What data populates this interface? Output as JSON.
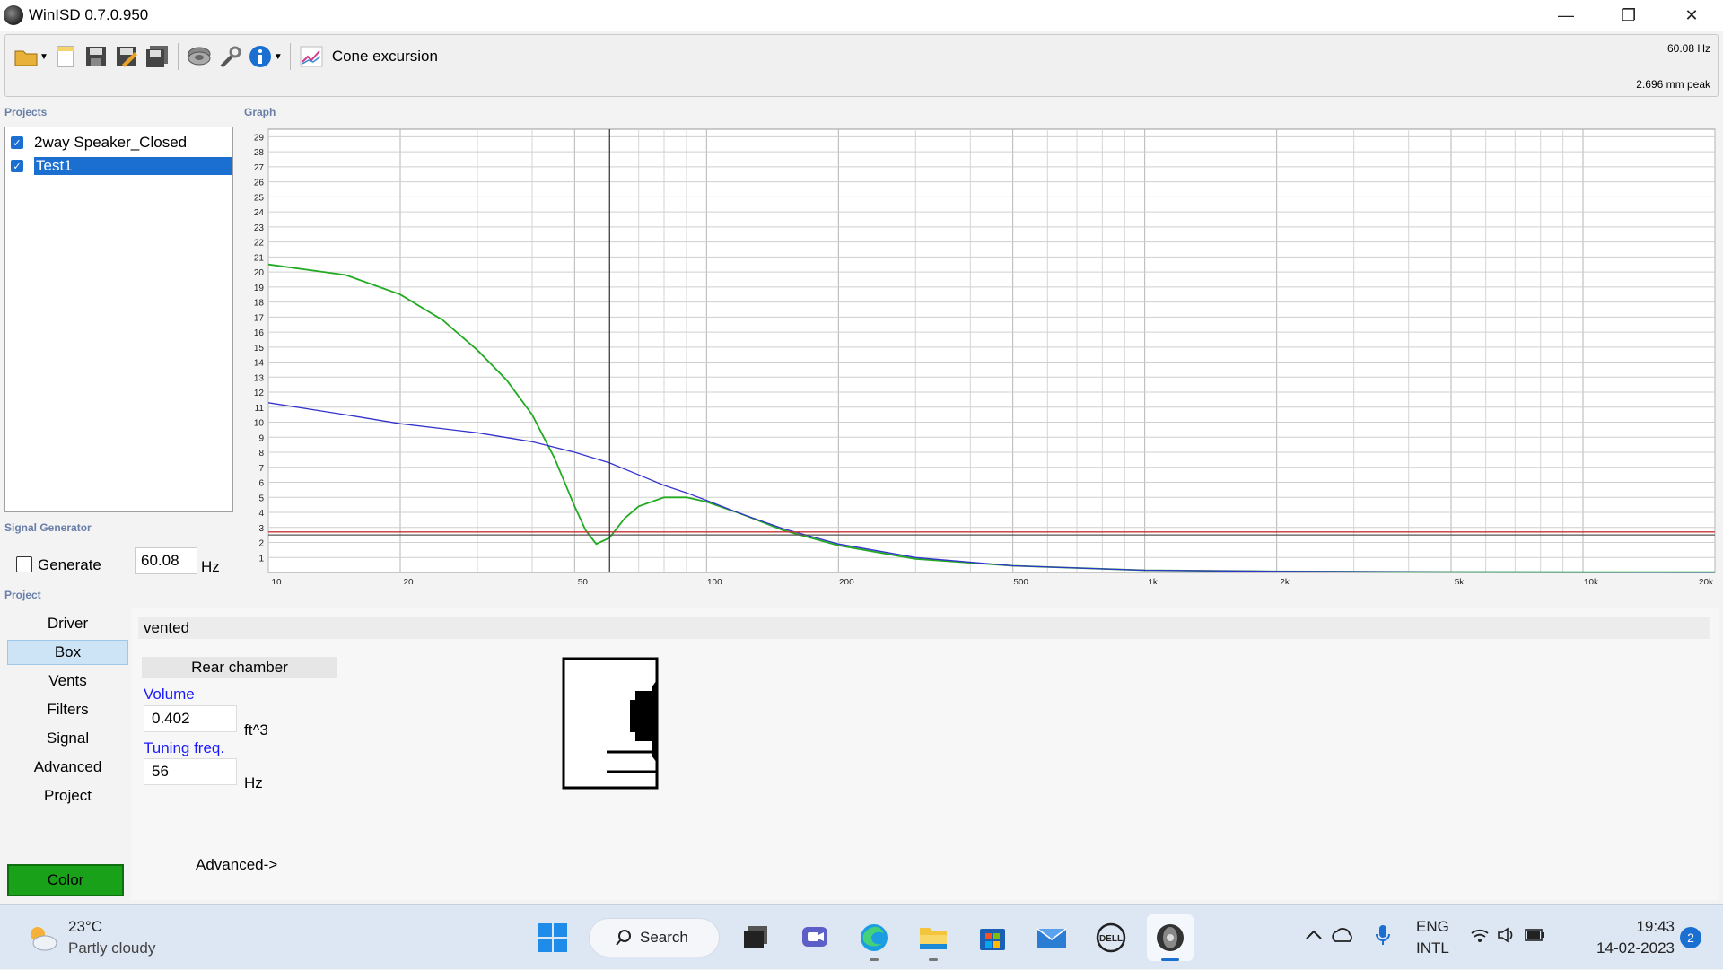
{
  "window": {
    "title": "WinISD 0.7.0.950",
    "minimize": "—",
    "maximize": "❐",
    "close": "✕"
  },
  "toolbar": {
    "mode_label": "Cone excursion",
    "freq_readout": "60.08 Hz",
    "peak_readout": "2.696 mm peak"
  },
  "sections": {
    "projects": "Projects",
    "graph": "Graph",
    "signal_generator": "Signal Generator",
    "project": "Project"
  },
  "projects": [
    {
      "name": "2way Speaker_Closed",
      "checked": true,
      "selected": false
    },
    {
      "name": "Test1",
      "checked": true,
      "selected": true
    }
  ],
  "signal_generator": {
    "generate_label": "Generate",
    "frequency": "60.08",
    "unit": "Hz"
  },
  "nav": [
    "Driver",
    "Box",
    "Vents",
    "Filters",
    "Signal",
    "Advanced",
    "Project"
  ],
  "nav_active": "Box",
  "color_button": "Color",
  "box_panel": {
    "box_type": "vented",
    "rear_chamber": "Rear chamber",
    "volume_label": "Volume",
    "volume_value": "0.402",
    "volume_unit": "ft^3",
    "tuning_label": "Tuning freq.",
    "tuning_value": "56",
    "tuning_unit": "Hz",
    "advanced_link": "Advanced->"
  },
  "chart_data": {
    "type": "line",
    "title": "",
    "xlabel": "",
    "ylabel": "",
    "x_scale": "log",
    "xlim": [
      10,
      20000
    ],
    "ylim": [
      0,
      29.5
    ],
    "x_ticks": [
      {
        "v": 10,
        "label": "10"
      },
      {
        "v": 20,
        "label": "20"
      },
      {
        "v": 50,
        "label": "50"
      },
      {
        "v": 100,
        "label": "100"
      },
      {
        "v": 200,
        "label": "200"
      },
      {
        "v": 500,
        "label": "500"
      },
      {
        "v": 1000,
        "label": "1k"
      },
      {
        "v": 2000,
        "label": "2k"
      },
      {
        "v": 5000,
        "label": "5k"
      },
      {
        "v": 10000,
        "label": "10k"
      },
      {
        "v": 20000,
        "label": "20k"
      }
    ],
    "y_ticks": [
      1,
      2,
      3,
      4,
      5,
      6,
      7,
      8,
      9,
      10,
      11,
      12,
      13,
      14,
      15,
      16,
      17,
      18,
      19,
      20,
      21,
      22,
      23,
      24,
      25,
      26,
      27,
      28,
      29
    ],
    "cursor_x": 60.08,
    "grid": true,
    "series": [
      {
        "color": "#22aa22",
        "points": [
          [
            10,
            20.5
          ],
          [
            15,
            19.8
          ],
          [
            20,
            18.5
          ],
          [
            25,
            16.8
          ],
          [
            30,
            14.8
          ],
          [
            35,
            12.8
          ],
          [
            40,
            10.5
          ],
          [
            45,
            7.6
          ],
          [
            50,
            4.4
          ],
          [
            53,
            2.8
          ],
          [
            56,
            1.9
          ],
          [
            60,
            2.3
          ],
          [
            65,
            3.6
          ],
          [
            70,
            4.4
          ],
          [
            80,
            5.0
          ],
          [
            90,
            5.0
          ],
          [
            100,
            4.7
          ],
          [
            120,
            3.9
          ],
          [
            150,
            2.8
          ],
          [
            200,
            1.8
          ],
          [
            300,
            0.9
          ],
          [
            500,
            0.45
          ],
          [
            1000,
            0.15
          ],
          [
            2000,
            0.07
          ],
          [
            5000,
            0.03
          ],
          [
            10000,
            0.02
          ],
          [
            20000,
            0.02
          ]
        ]
      },
      {
        "color": "#3333cc",
        "points": [
          [
            10,
            11.3
          ],
          [
            15,
            10.5
          ],
          [
            20,
            9.9
          ],
          [
            30,
            9.3
          ],
          [
            40,
            8.7
          ],
          [
            50,
            8.0
          ],
          [
            60,
            7.3
          ],
          [
            70,
            6.5
          ],
          [
            80,
            5.8
          ],
          [
            90,
            5.3
          ],
          [
            100,
            4.8
          ],
          [
            120,
            3.9
          ],
          [
            150,
            2.9
          ],
          [
            200,
            1.9
          ],
          [
            300,
            1.0
          ],
          [
            500,
            0.45
          ],
          [
            1000,
            0.15
          ],
          [
            2000,
            0.07
          ],
          [
            5000,
            0.03
          ],
          [
            20000,
            0.02
          ]
        ]
      },
      {
        "color": "#cc3333",
        "points": [
          [
            10,
            2.7
          ],
          [
            20000,
            2.7
          ]
        ]
      },
      {
        "color": "#555555",
        "points": [
          [
            10,
            2.5
          ],
          [
            20000,
            2.5
          ]
        ]
      }
    ]
  },
  "taskbar": {
    "temperature": "23°C",
    "weather": "Partly cloudy",
    "search": "Search",
    "lang1": "ENG",
    "lang2": "INTL",
    "time": "19:43",
    "date": "14-02-2023",
    "notifications": "2"
  }
}
